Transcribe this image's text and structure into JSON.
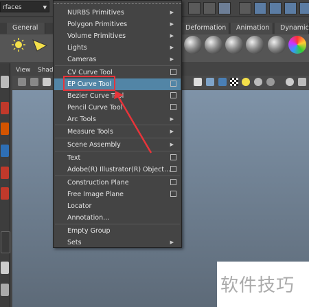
{
  "toolbar": {
    "mode_select": "rfaces"
  },
  "shelf": {
    "tabs": [
      "General",
      "Deformation",
      "Animation",
      "Dynamic"
    ]
  },
  "panel": {
    "menu": [
      "View",
      "Shad"
    ]
  },
  "menu": {
    "items": [
      {
        "label": "NURBS Primitives",
        "type": "submenu"
      },
      {
        "label": "Polygon Primitives",
        "type": "submenu"
      },
      {
        "label": "Volume Primitives",
        "type": "submenu"
      },
      {
        "label": "Lights",
        "type": "submenu"
      },
      {
        "label": "Cameras",
        "type": "submenu"
      },
      {
        "label": "CV Curve Tool",
        "type": "option"
      },
      {
        "label": "EP Curve Tool",
        "type": "option",
        "highlighted": true
      },
      {
        "label": "Bezier Curve Tool",
        "type": "option"
      },
      {
        "label": "Pencil Curve Tool",
        "type": "option"
      },
      {
        "label": "Arc Tools",
        "type": "submenu"
      },
      {
        "label": "Measure Tools",
        "type": "submenu"
      },
      {
        "label": "Scene Assembly",
        "type": "submenu"
      },
      {
        "label": "Text",
        "type": "option"
      },
      {
        "label": "Adobe(R) Illustrator(R) Object...",
        "type": "option"
      },
      {
        "label": "Construction Plane",
        "type": "option"
      },
      {
        "label": "Free Image Plane",
        "type": "option"
      },
      {
        "label": "Locator",
        "type": "plain"
      },
      {
        "label": "Annotation...",
        "type": "plain"
      },
      {
        "label": "Empty Group",
        "type": "plain"
      },
      {
        "label": "Sets",
        "type": "submenu"
      }
    ]
  },
  "watermark": "软件技巧",
  "colors": {
    "highlight": "#5285a6",
    "annotation": "#e8343a"
  }
}
